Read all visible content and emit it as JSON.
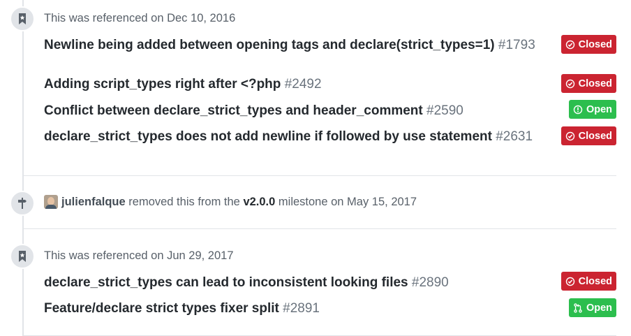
{
  "sections": [
    {
      "type": "reference",
      "meta_text": "This was referenced on Dec 10, 2016",
      "items": [
        {
          "title": "Newline being added between opening tags and declare(strict_types=1)",
          "number": "#1793",
          "state": "Closed"
        },
        {
          "title": "Adding script_types right after <?php",
          "number": "#2492",
          "state": "Closed"
        },
        {
          "title": "Conflict between declare_strict_types and header_comment",
          "number": "#2590",
          "state": "Open"
        },
        {
          "title": "declare_strict_types does not add newline if followed by use statement",
          "number": "#2631",
          "state": "Closed"
        }
      ]
    },
    {
      "type": "milestone",
      "author": "julienfalque",
      "text_before": "removed this from the",
      "milestone": "v2.0.0",
      "text_after": "milestone on May 15, 2017"
    },
    {
      "type": "reference",
      "meta_text": "This was referenced on Jun 29, 2017",
      "items": [
        {
          "title": "declare_strict_types can lead to inconsistent looking files",
          "number": "#2890",
          "state": "Closed"
        },
        {
          "title": "Feature/declare strict types fixer split",
          "number": "#2891",
          "state": "Open"
        }
      ]
    }
  ],
  "colors": {
    "closed": "#cb2431",
    "open": "#2cbe4e",
    "badge_bg": "#e1e4e8",
    "muted_text": "#586069",
    "number_text": "#6a737d"
  },
  "icons": {
    "reference_badge": "bookmark-icon",
    "milestone_badge": "milestone-icon",
    "closed_issue": "issue-closed-icon",
    "open_issue": "issue-opened-icon",
    "open_pr": "git-pull-request-icon"
  }
}
